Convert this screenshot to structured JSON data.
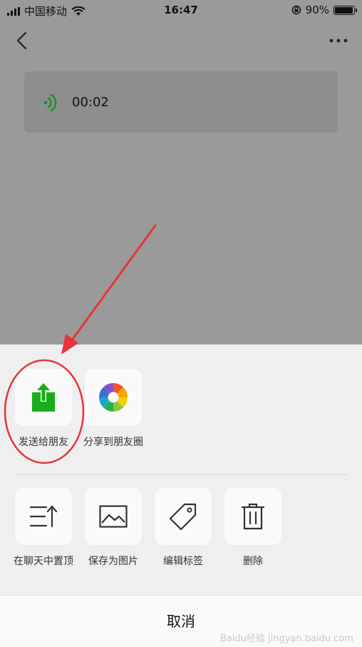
{
  "status_bar": {
    "carrier": "中国移动",
    "time": "16:47",
    "battery_percent": "90%",
    "battery_level": 0.9
  },
  "nav": {
    "back_icon": "chevron-left-icon",
    "more_icon": "more-horizontal-icon"
  },
  "voice_message": {
    "duration": "00:02",
    "icon": "voice-wave-icon",
    "icon_color": "#1a8f2a"
  },
  "actions_row1": [
    {
      "label": "发送给朋友",
      "icon": "share-upload-icon"
    },
    {
      "label": "分享到朋友圈",
      "icon": "moments-aperture-icon"
    }
  ],
  "actions_row2": [
    {
      "label": "在聊天中置顶",
      "icon": "pin-to-top-icon"
    },
    {
      "label": "保存为图片",
      "icon": "image-icon"
    },
    {
      "label": "编辑标签",
      "icon": "tag-icon"
    },
    {
      "label": "删除",
      "icon": "trash-icon"
    }
  ],
  "cancel_label": "取消",
  "watermark": "Baidu经验 jingyan.baidu.com",
  "colors": {
    "accent_green": "#1aad19",
    "annotation_red": "#e8343a",
    "overlay_gray": "#9a9a9a"
  }
}
